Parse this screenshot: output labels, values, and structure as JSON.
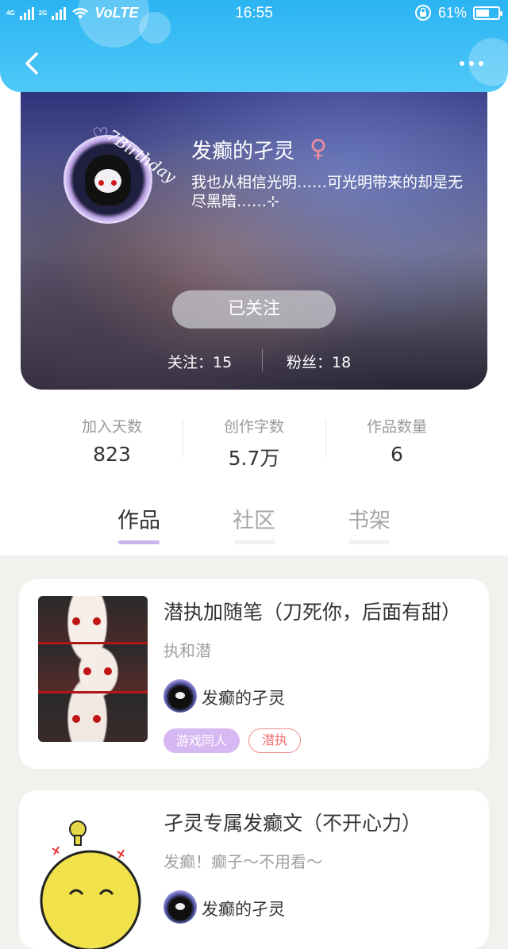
{
  "status_bar": {
    "network": "4G",
    "network2": "2G",
    "volte": "VoLTE",
    "time": "16:55",
    "battery": "61%",
    "battery_level": 0.61
  },
  "profile": {
    "name": "发癫的孑灵",
    "gender_symbol": "♀",
    "bio": "我也从相信光明……可光明带来的却是无尽黑暗……⊹",
    "avatar_text": "7Birthday",
    "follow_button": "已关注",
    "following_label": "关注：15",
    "fans_label": "粉丝：18"
  },
  "stats": [
    {
      "label": "加入天数",
      "value": "823"
    },
    {
      "label": "创作字数",
      "value": "5.7万"
    },
    {
      "label": "作品数量",
      "value": "6"
    }
  ],
  "tabs": [
    "作品",
    "社区",
    "书架"
  ],
  "active_tab": "作品",
  "works": [
    {
      "title": "潜执加随笔（刀死你，后面有甜）",
      "subtitle": "执和潜",
      "author": "发癫的孑灵",
      "tags": [
        "游戏同人",
        "潜执"
      ]
    },
    {
      "title": "孑灵专属发癫文（不开心力）",
      "subtitle": "发癫！癫子～不用看～",
      "author": "发癫的孑灵"
    }
  ]
}
